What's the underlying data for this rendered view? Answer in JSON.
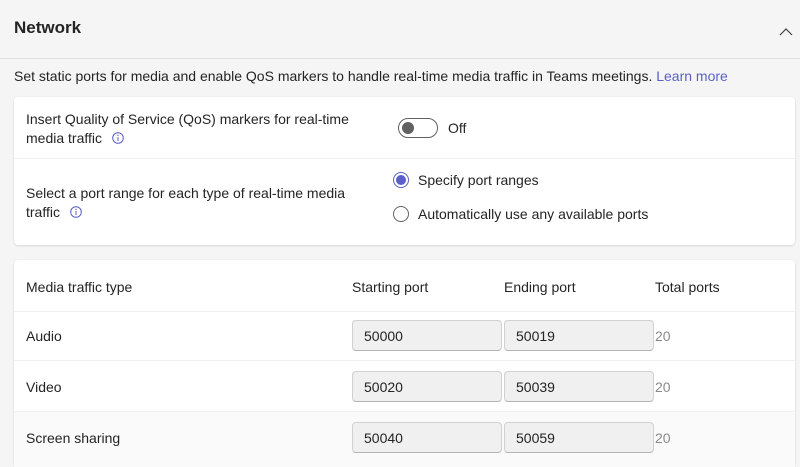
{
  "section": {
    "title": "Network",
    "description": "Set static ports for media and enable QoS markers to handle real-time media traffic in Teams meetings.",
    "learn_more": "Learn more"
  },
  "qos": {
    "label_line1": "Insert Quality of Service (QoS) markers for real-time",
    "label_line2": "media traffic",
    "toggle_state": "Off",
    "toggle_on": false
  },
  "port_range": {
    "label_line1": "Select a port range for each type of real-time media",
    "label_line2": "traffic",
    "options": [
      {
        "label": "Specify port ranges",
        "selected": true
      },
      {
        "label": "Automatically use any available ports",
        "selected": false
      }
    ]
  },
  "table": {
    "headers": {
      "type": "Media traffic type",
      "start": "Starting port",
      "end": "Ending port",
      "total": "Total ports"
    },
    "rows": [
      {
        "type": "Audio",
        "start": "50000",
        "end": "50019",
        "total": "20"
      },
      {
        "type": "Video",
        "start": "50020",
        "end": "50039",
        "total": "20"
      },
      {
        "type": "Screen sharing",
        "start": "50040",
        "end": "50059",
        "total": "20"
      }
    ]
  },
  "colors": {
    "accent": "#5b5fc7",
    "text": "#242424",
    "muted": "#8a8a8a"
  }
}
